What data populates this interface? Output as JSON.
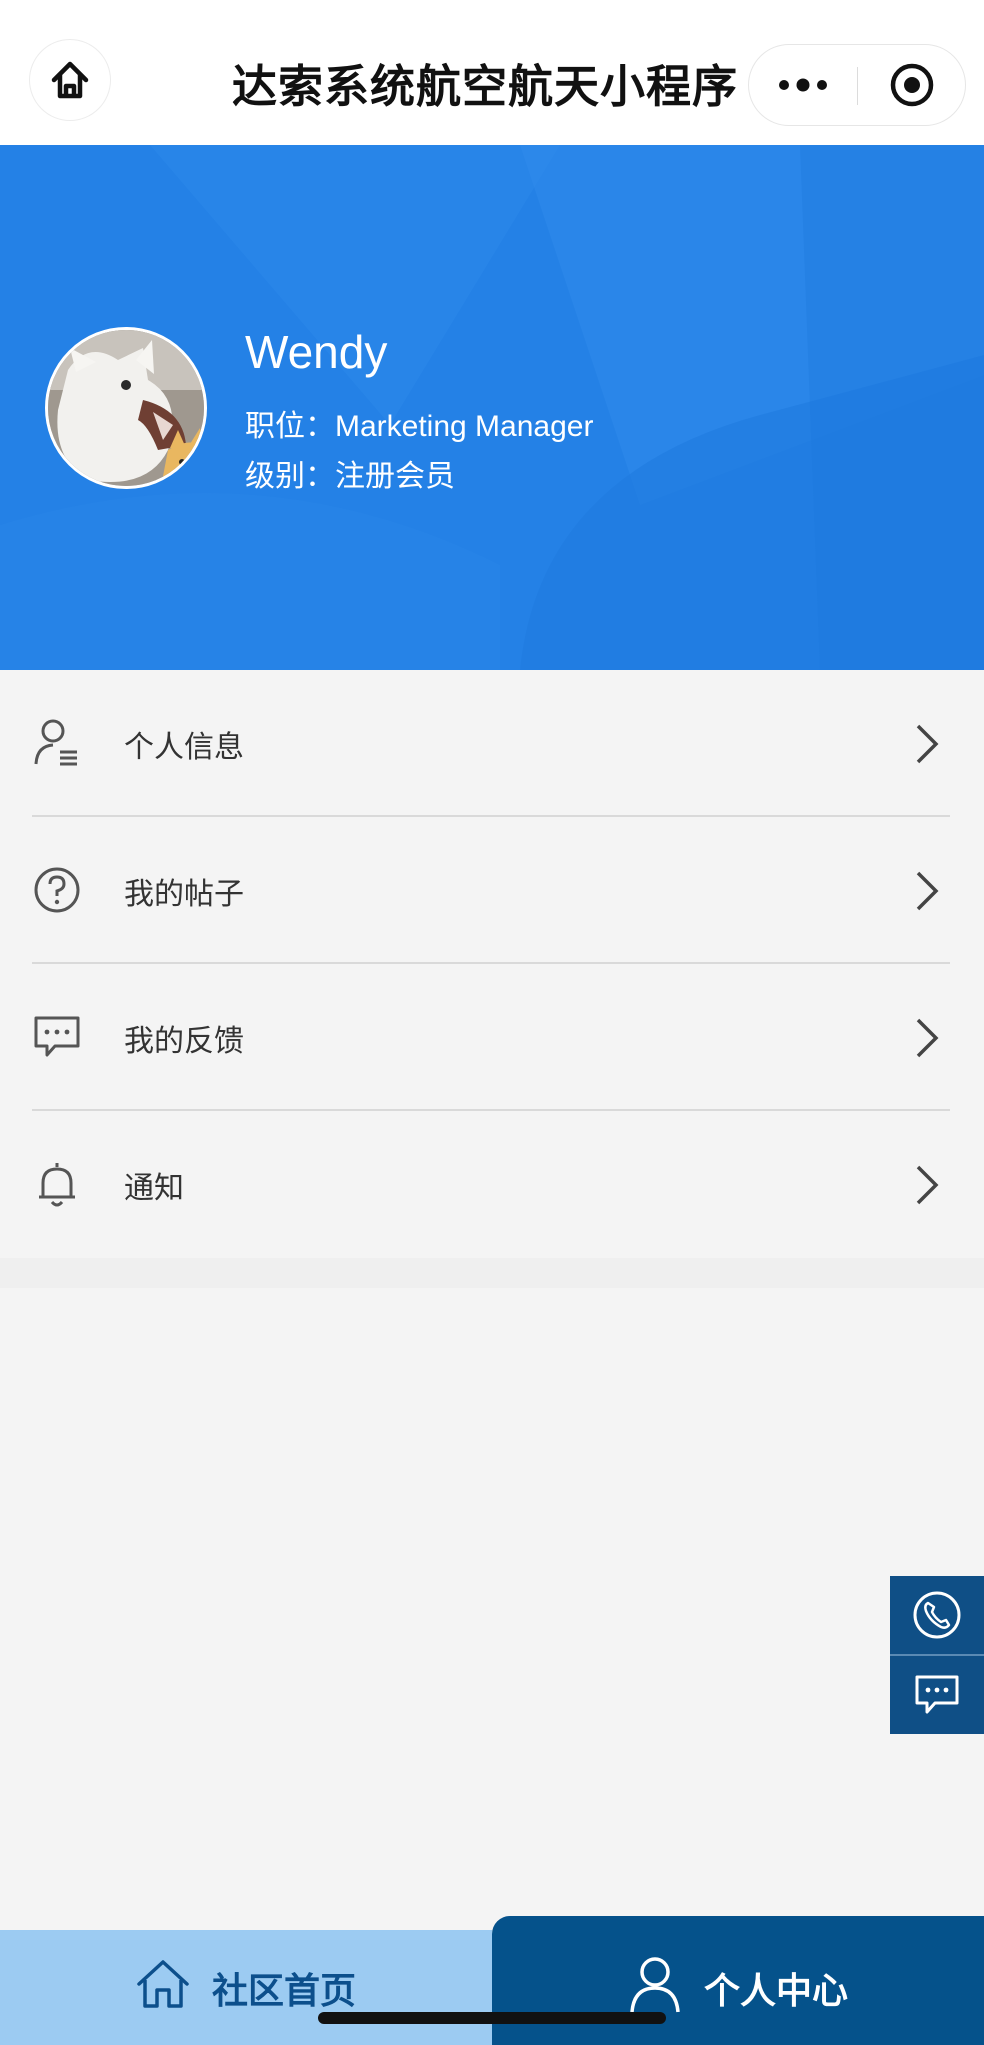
{
  "app": {
    "title": "达索系统航空航天小程序"
  },
  "profile": {
    "name": "Wendy",
    "position_label": "职位：",
    "position_value": "Marketing Manager",
    "level_label": "级别：",
    "level_value": "注册会员"
  },
  "menu": {
    "items": [
      {
        "label": "个人信息",
        "icon": "user-list-icon"
      },
      {
        "label": "我的帖子",
        "icon": "question-circle-icon"
      },
      {
        "label": "我的反馈",
        "icon": "chat-bubble-icon"
      },
      {
        "label": "通知",
        "icon": "bell-icon"
      }
    ]
  },
  "float_buttons": [
    {
      "icon": "phone-icon"
    },
    {
      "icon": "message-icon"
    }
  ],
  "tabbar": {
    "tabs": [
      {
        "label": "社区首页",
        "icon": "home-icon",
        "active": false
      },
      {
        "label": "个人中心",
        "icon": "person-icon",
        "active": true
      }
    ]
  },
  "colors": {
    "hero_blue": "#2481e6",
    "tab_active": "#05528b",
    "tab_inactive": "#9ccbf2",
    "float_button": "#0f4f86"
  }
}
